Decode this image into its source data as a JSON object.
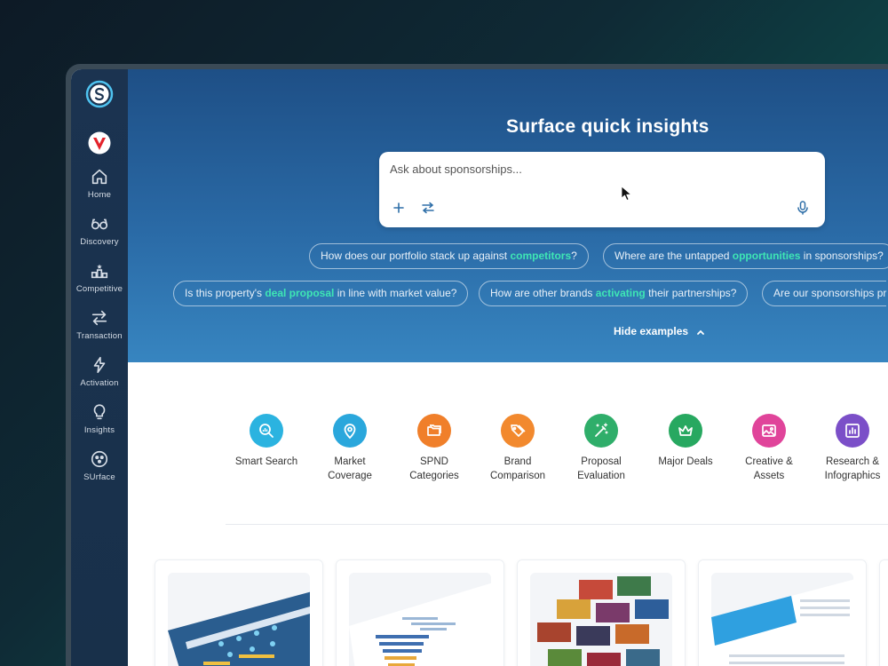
{
  "sidebar": {
    "items": [
      {
        "label": "Home",
        "icon": "home-icon"
      },
      {
        "label": "Discovery",
        "icon": "glasses-icon"
      },
      {
        "label": "Competitive",
        "icon": "podium-icon"
      },
      {
        "label": "Transaction",
        "icon": "swap-arrows-icon"
      },
      {
        "label": "Activation",
        "icon": "lightning-icon"
      },
      {
        "label": "Insights",
        "icon": "lightbulb-icon"
      },
      {
        "label": "SUrface",
        "icon": "surface-icon"
      }
    ]
  },
  "hero": {
    "title": "Surface quick insights",
    "ask_placeholder": "Ask about sponsorships...",
    "hide_examples": "Hide examples"
  },
  "chips": [
    {
      "pre": "How does our portfolio stack up against ",
      "bold": "competitors",
      "post": "?"
    },
    {
      "pre": "Where are the untapped ",
      "bold": "opportunities",
      "post": " in sponsorships?"
    },
    {
      "pre": "Is this property's ",
      "bold": "deal proposal",
      "post": " in line with market value?"
    },
    {
      "pre": "How are other brands ",
      "bold": "activating",
      "post": " their partnerships?"
    },
    {
      "pre": "Are our sponsorships pr",
      "bold": "",
      "post": ""
    }
  ],
  "tiles": [
    {
      "label1": "Smart Search",
      "label2": "",
      "color": "#2bb3e0",
      "icon": "search-icon"
    },
    {
      "label1": "Market",
      "label2": "Coverage",
      "color": "#2aa7dc",
      "icon": "location-pin-icon"
    },
    {
      "label1": "SPND",
      "label2": "Categories",
      "color": "#f07f2a",
      "icon": "folders-icon"
    },
    {
      "label1": "Brand",
      "label2": "Comparison",
      "color": "#f2892e",
      "icon": "tags-icon"
    },
    {
      "label1": "Proposal",
      "label2": "Evaluation",
      "color": "#2fae6a",
      "icon": "magic-wand-icon"
    },
    {
      "label1": "Major Deals",
      "label2": "",
      "color": "#27a860",
      "icon": "crown-icon"
    },
    {
      "label1": "Creative &",
      "label2": "Assets",
      "color": "#e0449a",
      "icon": "image-icon"
    },
    {
      "label1": "Research &",
      "label2": "Infographics",
      "color": "#7b4fc8",
      "icon": "bar-chart-icon"
    }
  ],
  "colors": {
    "accent": "#3ee6b4",
    "sidebar": "#1b3350",
    "hero_top": "#1e4f86",
    "hero_bottom": "#3785c0"
  }
}
